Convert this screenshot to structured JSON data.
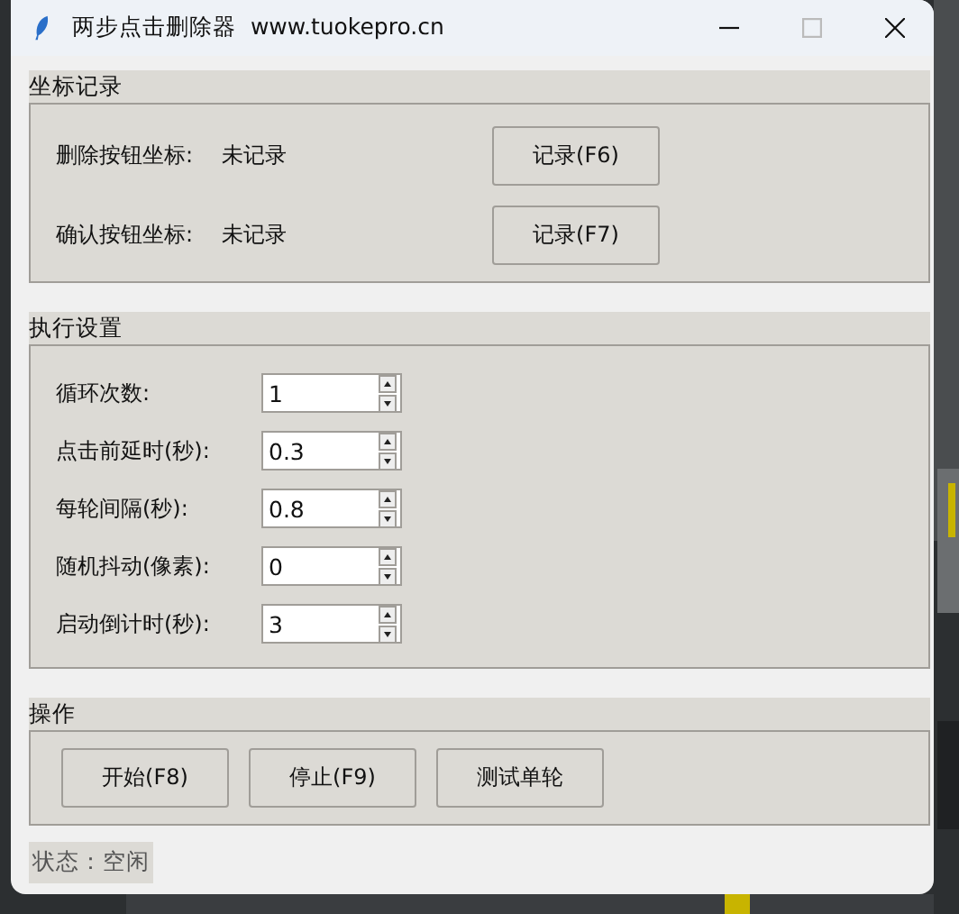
{
  "window": {
    "title": "两步点击删除器  www.tuokepro.cn"
  },
  "coordinates": {
    "title": "坐标记录",
    "rows": [
      {
        "label": "删除按钮坐标:",
        "value": "未记录",
        "button": "记录(F6)"
      },
      {
        "label": "确认按钮坐标:",
        "value": "未记录",
        "button": "记录(F7)"
      }
    ]
  },
  "settings": {
    "title": "执行设置",
    "fields": [
      {
        "label": "循环次数:",
        "value": "1"
      },
      {
        "label": "点击前延时(秒):",
        "value": "0.3"
      },
      {
        "label": "每轮间隔(秒):",
        "value": "0.8"
      },
      {
        "label": "随机抖动(像素):",
        "value": "0"
      },
      {
        "label": "启动倒计时(秒):",
        "value": "3"
      }
    ]
  },
  "actions": {
    "title": "操作",
    "buttons": [
      "开始(F8)",
      "停止(F9)",
      "测试单轮"
    ]
  },
  "status_bar": "状态：空闲"
}
